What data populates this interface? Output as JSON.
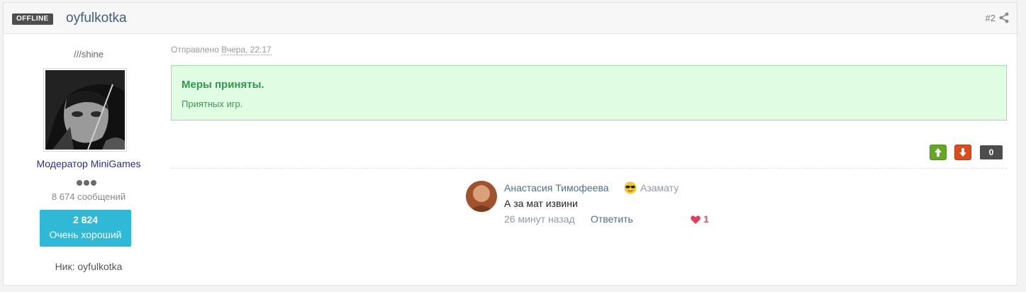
{
  "header": {
    "status_badge": "OFFLINE",
    "author": "oyfulkotka",
    "post_number": "#2",
    "share_icon": "share-icon"
  },
  "author_panel": {
    "title": "///shine",
    "group": "Модератор MiniGames",
    "rank_pips": 3,
    "posts": "8 674 сообщений",
    "reputation_value": "2 824",
    "reputation_label": "Очень хороший",
    "nick": "Ник: oyfulkotka"
  },
  "post": {
    "sent_prefix": "Отправлено",
    "sent_date": "Вчера, 22:17",
    "notice_title": "Меры приняты.",
    "notice_text": "Приятных игр.",
    "vote_up_icon": "arrow-up-icon",
    "vote_down_icon": "arrow-down-icon",
    "score": "0"
  },
  "comment": {
    "name": "Анастасия Тимофеева",
    "emoji": "sunglasses-emoji-icon",
    "reply_to": "Азамату",
    "text": "А за мат извини",
    "time": "26 минут назад",
    "reply_label": "Ответить",
    "likes": "1"
  },
  "colors": {
    "link": "#3f5e82",
    "group": "#2a2aa8",
    "reputation": "#2fb9d6",
    "notice_bg": "#e0fde3",
    "notice_text": "#2f9a4c",
    "vote_up": "#63a923",
    "vote_down": "#dd4a1b"
  }
}
